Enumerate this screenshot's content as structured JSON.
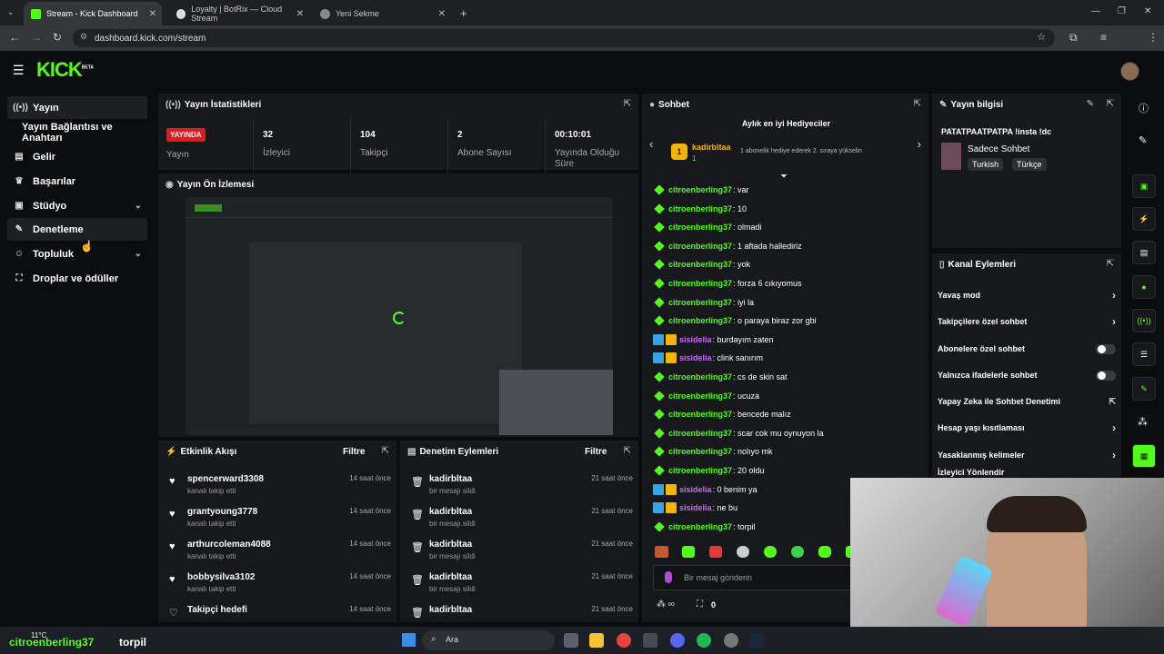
{
  "browser": {
    "tabs": [
      {
        "title": "Stream - Kick Dashboard",
        "active": true
      },
      {
        "title": "Loyalty | BotRix — Cloud Stream",
        "active": false
      },
      {
        "title": "Yeni Sekme",
        "active": false
      }
    ],
    "url": "dashboard.kick.com/stream"
  },
  "app": {
    "logo": "KICK",
    "logo_tag": "BETA",
    "brand_color": "#53fc18"
  },
  "sidebar": {
    "items": [
      {
        "label": "Yayın",
        "icon": "broadcast-icon"
      },
      {
        "label": "Yayın Bağlantısı ve Anahtarı",
        "icon": ""
      },
      {
        "label": "Gelir",
        "icon": "revenue-icon"
      },
      {
        "label": "Başarılar",
        "icon": "trophy-icon"
      },
      {
        "label": "Stüdyo",
        "icon": "studio-icon"
      },
      {
        "label": "Denetleme",
        "icon": "wrench-icon"
      },
      {
        "label": "Topluluk",
        "icon": "community-icon"
      },
      {
        "label": "Droplar ve ödüller",
        "icon": "gift-icon"
      }
    ]
  },
  "stats": {
    "title": "Yayın İstatistikleri",
    "live_badge": "YAYINDA",
    "live_label": "Yayın",
    "items": [
      {
        "value": "32",
        "label": "İzleyici"
      },
      {
        "value": "104",
        "label": "Takipçi"
      },
      {
        "value": "2",
        "label": "Abone Sayısı"
      },
      {
        "value": "00:10:01",
        "label": "Yayında Olduğu Süre"
      }
    ]
  },
  "preview": {
    "title": "Yayın Ön İzlemesi"
  },
  "activity": {
    "title": "Etkinlik Akışı",
    "filter": "Filtre",
    "rows": [
      {
        "name": "spencerward3308",
        "sub": "kanalı takip etti",
        "time": "14 saat önce"
      },
      {
        "name": "grantyoung3778",
        "sub": "kanalı takip etti",
        "time": "14 saat önce"
      },
      {
        "name": "arthurcoleman4088",
        "sub": "kanalı takip etti",
        "time": "14 saat önce"
      },
      {
        "name": "bobbysilva3102",
        "sub": "kanalı takip etti",
        "time": "14 saat önce"
      },
      {
        "name": "Takipçi hedefi",
        "sub": "",
        "time": "14 saat önce"
      }
    ]
  },
  "moderation": {
    "title": "Denetim Eylemleri",
    "filter": "Filtre",
    "rows": [
      {
        "name": "kadirbltaa",
        "sub": "bir mesajı sildi",
        "time": "21 saat önce"
      },
      {
        "name": "kadirbltaa",
        "sub": "bir mesajı sildi",
        "time": "21 saat önce"
      },
      {
        "name": "kadirbltaa",
        "sub": "bir mesajı sildi",
        "time": "21 saat önce"
      },
      {
        "name": "kadirbltaa",
        "sub": "bir mesajı sildi",
        "time": "21 saat önce"
      },
      {
        "name": "kadirbltaa",
        "sub": "",
        "time": "21 saat önce"
      }
    ]
  },
  "chat": {
    "title": "Sohbet",
    "gifters_title": "Aylık en iyi Hediyeciler",
    "top_gifter": {
      "rank": "1",
      "name": "kadirbltaa",
      "count": "1"
    },
    "gifter_hint": "1 abonelik hediye ederek 2. sıraya yükselin",
    "messages": [
      {
        "user": "citroenberling37",
        "text": ": var",
        "badge": "diamond"
      },
      {
        "user": "citroenberling37",
        "text": ": 10",
        "badge": "diamond"
      },
      {
        "user": "citroenberling37",
        "text": ": olmadi",
        "badge": "diamond"
      },
      {
        "user": "citroenberling37",
        "text": ": 1 aftada hallediriz",
        "badge": "diamond"
      },
      {
        "user": "citroenberling37",
        "text": ": yok",
        "badge": "diamond"
      },
      {
        "user": "citroenberling37",
        "text": ": forza 6 cıkıyomus",
        "badge": "diamond"
      },
      {
        "user": "citroenberling37",
        "text": ": iyi la",
        "badge": "diamond"
      },
      {
        "user": "citroenberling37",
        "text": ": o paraya biraz zor gbi",
        "badge": "diamond"
      },
      {
        "user": "sisidelia",
        "text": ": burdayım zaten",
        "badge": "mod"
      },
      {
        "user": "sisidelia",
        "text": ": clink sanırım",
        "badge": "mod"
      },
      {
        "user": "citroenberling37",
        "text": ": cs de skin sat",
        "badge": "diamond"
      },
      {
        "user": "citroenberling37",
        "text": ": ucuza",
        "badge": "diamond"
      },
      {
        "user": "citroenberling37",
        "text": ": bencede malız",
        "badge": "diamond"
      },
      {
        "user": "citroenberling37",
        "text": ": scar cok mu oynuyon la",
        "badge": "diamond"
      },
      {
        "user": "citroenberling37",
        "text": ": nolıyo mk",
        "badge": "diamond"
      },
      {
        "user": "citroenberling37",
        "text": ": 20 oldu",
        "badge": "diamond"
      },
      {
        "user": "sisidelia",
        "text": ": 0 benim ya",
        "badge": "mod"
      },
      {
        "user": "sisidelia",
        "text": ": ne bu",
        "badge": "mod"
      },
      {
        "user": "citroenberling37",
        "text": ": torpil",
        "badge": "diamond"
      }
    ],
    "input_placeholder": "Bir mesaj gönderin",
    "points": "0",
    "colors": {
      "green_user": "#53fc18",
      "purple_user": "#c86bf5"
    }
  },
  "stream_info": {
    "title": "Yayın bilgisi",
    "stream_title": "PATATPAATPATPA !insta !dc",
    "category": "Sadece Sohbet",
    "tags": [
      "Turkish",
      "Türkçe"
    ]
  },
  "channel_actions": {
    "title": "Kanal Eylemleri",
    "items": [
      {
        "label": "Yavaş mod",
        "kind": "arrow"
      },
      {
        "label": "Takipçilere özel sohbet",
        "kind": "arrow"
      },
      {
        "label": "Abonelere özel sohbet",
        "kind": "toggle"
      },
      {
        "label": "Yalnızca ifadelerle sohbet",
        "kind": "toggle"
      },
      {
        "label": "Yapay Zeka ile Sohbet Denetimi",
        "kind": "external"
      },
      {
        "label": "Hesap yaşı kısıtlaması",
        "kind": "arrow"
      },
      {
        "label": "Yasaklanmış kelimeler",
        "kind": "arrow"
      },
      {
        "label": "İzleyici Yönlendir",
        "kind": "arrow"
      }
    ]
  },
  "overlay": {
    "name": "citroenberling37",
    "text": "torpil"
  },
  "taskbar": {
    "weather": "11°C",
    "search": "Ara"
  }
}
